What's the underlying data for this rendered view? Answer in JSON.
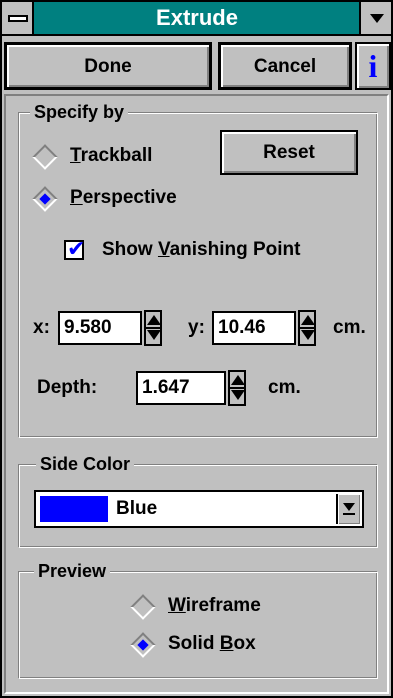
{
  "window": {
    "title": "Extrude"
  },
  "buttons": {
    "done": "Done",
    "cancel": "Cancel",
    "info": "i",
    "reset": "Reset"
  },
  "specify": {
    "legend": "Specify by",
    "trackball_label": "Trackball",
    "trackball_selected": false,
    "perspective_label": "Perspective",
    "perspective_selected": true,
    "show_vp_label": "Show Vanishing Point",
    "show_vp_checked": true,
    "x_label": "x:",
    "x_value": "9.580",
    "y_label": "y:",
    "y_value": "10.46",
    "xy_unit": "cm.",
    "depth_label": "Depth:",
    "depth_value": "1.647",
    "depth_unit": "cm."
  },
  "side_color": {
    "legend": "Side Color",
    "selected": "Blue",
    "swatch_color": "#0000ff"
  },
  "preview": {
    "legend": "Preview",
    "wireframe_label": "Wireframe",
    "wireframe_selected": false,
    "solid_label": "Solid Box",
    "solid_selected": true
  },
  "colors": {
    "titlebar": "#008080",
    "face": "#c0c0c0",
    "accent": "#0000ff"
  },
  "icons": [
    "system-menu-icon",
    "minimize-icon",
    "info-icon",
    "spin-up-down-icon",
    "dropdown-arrow-icon"
  ]
}
